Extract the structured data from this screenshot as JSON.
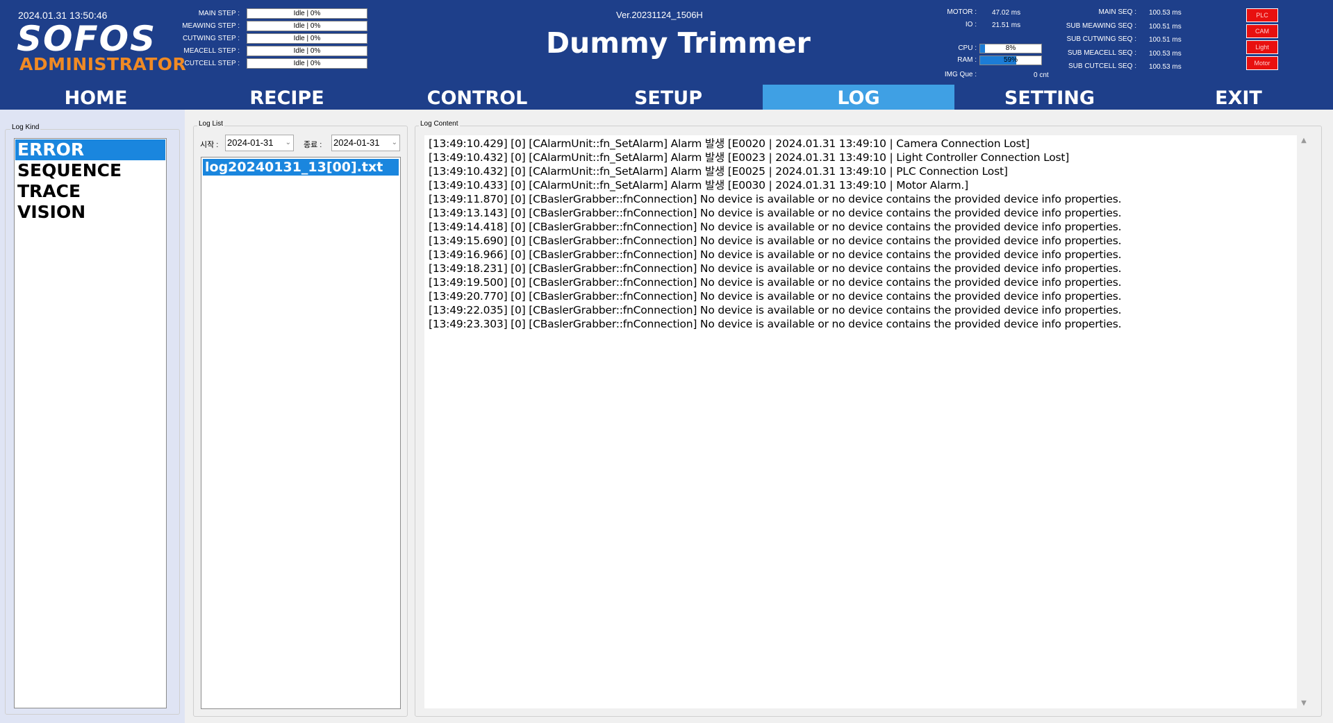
{
  "header": {
    "datetime": "2024.01.31 13:50:46",
    "logo": "SOFOS",
    "user_level": "ADMINISTRATOR",
    "version": "Ver.20231124_1506H",
    "title": "Dummy Trimmer",
    "steps": [
      {
        "label": "MAIN STEP :",
        "value": "Idle | 0%"
      },
      {
        "label": "MEAWING STEP :",
        "value": "Idle | 0%"
      },
      {
        "label": "CUTWING STEP :",
        "value": "Idle | 0%"
      },
      {
        "label": "MEACELL STEP :",
        "value": "Idle | 0%"
      },
      {
        "label": "CUTCELL STEP :",
        "value": "Idle | 0%"
      }
    ],
    "timing": {
      "motor_label": "MOTOR :",
      "motor_value": "47.02 ms",
      "io_label": "IO :",
      "io_value": "21.51 ms",
      "cpu_label": "CPU :",
      "cpu_value": "8%",
      "cpu_percent": 8,
      "ram_label": "RAM :",
      "ram_value": "59%",
      "ram_percent": 59,
      "imgque_label": "IMG Que :",
      "imgque_value": "0 cnt"
    },
    "seq": [
      {
        "label": "MAIN SEQ :",
        "value": "100.53 ms"
      },
      {
        "label": "SUB MEAWING SEQ :",
        "value": "100.51 ms"
      },
      {
        "label": "SUB CUTWING SEQ :",
        "value": "100.51 ms"
      },
      {
        "label": "SUB MEACELL SEQ :",
        "value": "100.53 ms"
      },
      {
        "label": "SUB CUTCELL SEQ :",
        "value": "100.53 ms"
      }
    ],
    "indicators": [
      {
        "label": "PLC",
        "color": "#e8100f"
      },
      {
        "label": "CAM",
        "color": "#e8100f"
      },
      {
        "label": "Light",
        "color": "#e8100f"
      },
      {
        "label": "Motor",
        "color": "#e8100f"
      }
    ]
  },
  "tabs": [
    {
      "label": "HOME",
      "active": false
    },
    {
      "label": "RECIPE",
      "active": false
    },
    {
      "label": "CONTROL",
      "active": false
    },
    {
      "label": "SETUP",
      "active": false
    },
    {
      "label": "LOG",
      "active": true
    },
    {
      "label": "SETTING",
      "active": false
    },
    {
      "label": "EXIT",
      "active": false
    }
  ],
  "log_kind": {
    "title": "Log Kind",
    "items": [
      "ERROR",
      "SEQUENCE",
      "TRACE",
      "VISION"
    ],
    "selected": "ERROR"
  },
  "log_list": {
    "title": "Log List",
    "start_label": "시작 :",
    "start_date": "2024-01-31",
    "end_label": "종료 :",
    "end_date": "2024-01-31",
    "files": [
      "log20240131_13[00].txt"
    ]
  },
  "log_content": {
    "title": "Log Content",
    "lines": [
      "[13:49:10.429] [0] [CAlarmUnit::fn_SetAlarm] Alarm 발생 [E0020 | 2024.01.31 13:49:10 | Camera Connection Lost]",
      "[13:49:10.432] [0] [CAlarmUnit::fn_SetAlarm] Alarm 발생 [E0023 | 2024.01.31 13:49:10 | Light Controller Connection Lost]",
      "[13:49:10.432] [0] [CAlarmUnit::fn_SetAlarm] Alarm 발생 [E0025 | 2024.01.31 13:49:10 | PLC Connection Lost]",
      "[13:49:10.433] [0] [CAlarmUnit::fn_SetAlarm] Alarm 발생 [E0030 | 2024.01.31 13:49:10 | Motor Alarm.]",
      "[13:49:11.870] [0] [CBaslerGrabber::fnConnection] No device is available or no device contains the provided device info properties.",
      "[13:49:13.143] [0] [CBaslerGrabber::fnConnection] No device is available or no device contains the provided device info properties.",
      "[13:49:14.418] [0] [CBaslerGrabber::fnConnection] No device is available or no device contains the provided device info properties.",
      "[13:49:15.690] [0] [CBaslerGrabber::fnConnection] No device is available or no device contains the provided device info properties.",
      "[13:49:16.966] [0] [CBaslerGrabber::fnConnection] No device is available or no device contains the provided device info properties.",
      "[13:49:18.231] [0] [CBaslerGrabber::fnConnection] No device is available or no device contains the provided device info properties.",
      "[13:49:19.500] [0] [CBaslerGrabber::fnConnection] No device is available or no device contains the provided device info properties.",
      "[13:49:20.770] [0] [CBaslerGrabber::fnConnection] No device is available or no device contains the provided device info properties.",
      "[13:49:22.035] [0] [CBaslerGrabber::fnConnection] No device is available or no device contains the provided device info properties.",
      "[13:49:23.303] [0] [CBaslerGrabber::fnConnection] No device is available or no device contains the provided device info properties."
    ]
  }
}
